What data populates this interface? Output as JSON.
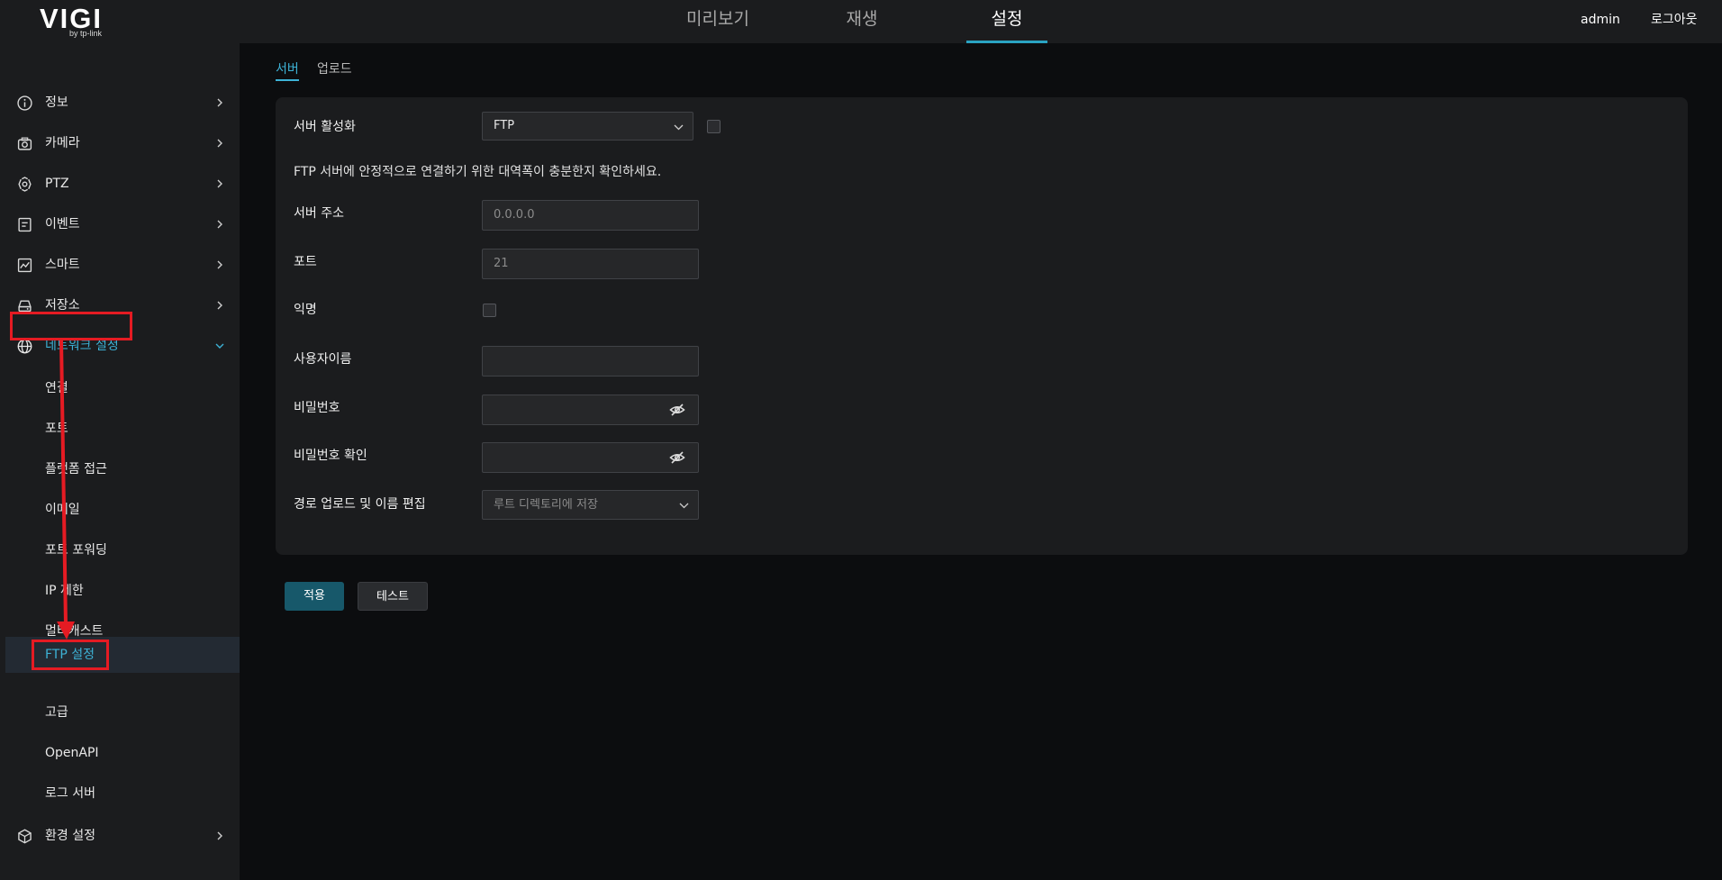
{
  "brand": {
    "logo_text": "VIGI",
    "logo_sub": "by tp-link"
  },
  "topnav": {
    "tabs": [
      {
        "label": "미리보기",
        "active": false
      },
      {
        "label": "재생",
        "active": false
      },
      {
        "label": "설정",
        "active": true
      }
    ],
    "user": "admin",
    "logout": "로그아웃"
  },
  "sidebar": {
    "items": [
      {
        "label": "정보",
        "icon": "info-icon"
      },
      {
        "label": "카메라",
        "icon": "camera-icon"
      },
      {
        "label": "PTZ",
        "icon": "ptz-icon"
      },
      {
        "label": "이벤트",
        "icon": "event-icon"
      },
      {
        "label": "스마트",
        "icon": "smart-icon"
      },
      {
        "label": "저장소",
        "icon": "storage-icon"
      },
      {
        "label": "네트워크 설정",
        "icon": "globe-icon",
        "expanded": true
      }
    ],
    "subitems": [
      {
        "label": "연결"
      },
      {
        "label": "포트"
      },
      {
        "label": "플랫폼 접근"
      },
      {
        "label": "이메일"
      },
      {
        "label": "포트 포워딩"
      },
      {
        "label": "IP 제한"
      },
      {
        "label": "멀티캐스트"
      },
      {
        "label": "FTP 설정",
        "active": true
      },
      {
        "label": "고급"
      },
      {
        "label": "OpenAPI"
      },
      {
        "label": "로그 서버"
      }
    ],
    "system": {
      "label": "환경 설정",
      "icon": "cube-icon"
    }
  },
  "subtabs": [
    {
      "label": "서버",
      "active": true
    },
    {
      "label": "업로드",
      "active": false
    }
  ],
  "form": {
    "server_enable": {
      "label": "서버 활성화",
      "value": "FTP",
      "checked": false
    },
    "notice": "FTP 서버에 안정적으로 연결하기 위한 대역폭이 충분한지 확인하세요.",
    "server_address": {
      "label": "서버 주소",
      "placeholder": "0.0.0.0"
    },
    "port": {
      "label": "포트",
      "value": "21"
    },
    "anonymous": {
      "label": "익명",
      "checked": false
    },
    "username": {
      "label": "사용자이름",
      "value": ""
    },
    "password": {
      "label": "비밀번호",
      "value": ""
    },
    "password_confirm": {
      "label": "비밀번호 확인",
      "value": ""
    },
    "path": {
      "label": "경로 업로드 및 이름 편집",
      "value": "루트 디렉토리에 저장"
    }
  },
  "buttons": {
    "apply": "적용",
    "test": "테스트"
  },
  "colors": {
    "accent": "#3db2d6",
    "apply_button": "#17586a",
    "annotation": "#e51b23",
    "panel": "#1b1c1e",
    "background": "#0c0d0f"
  }
}
